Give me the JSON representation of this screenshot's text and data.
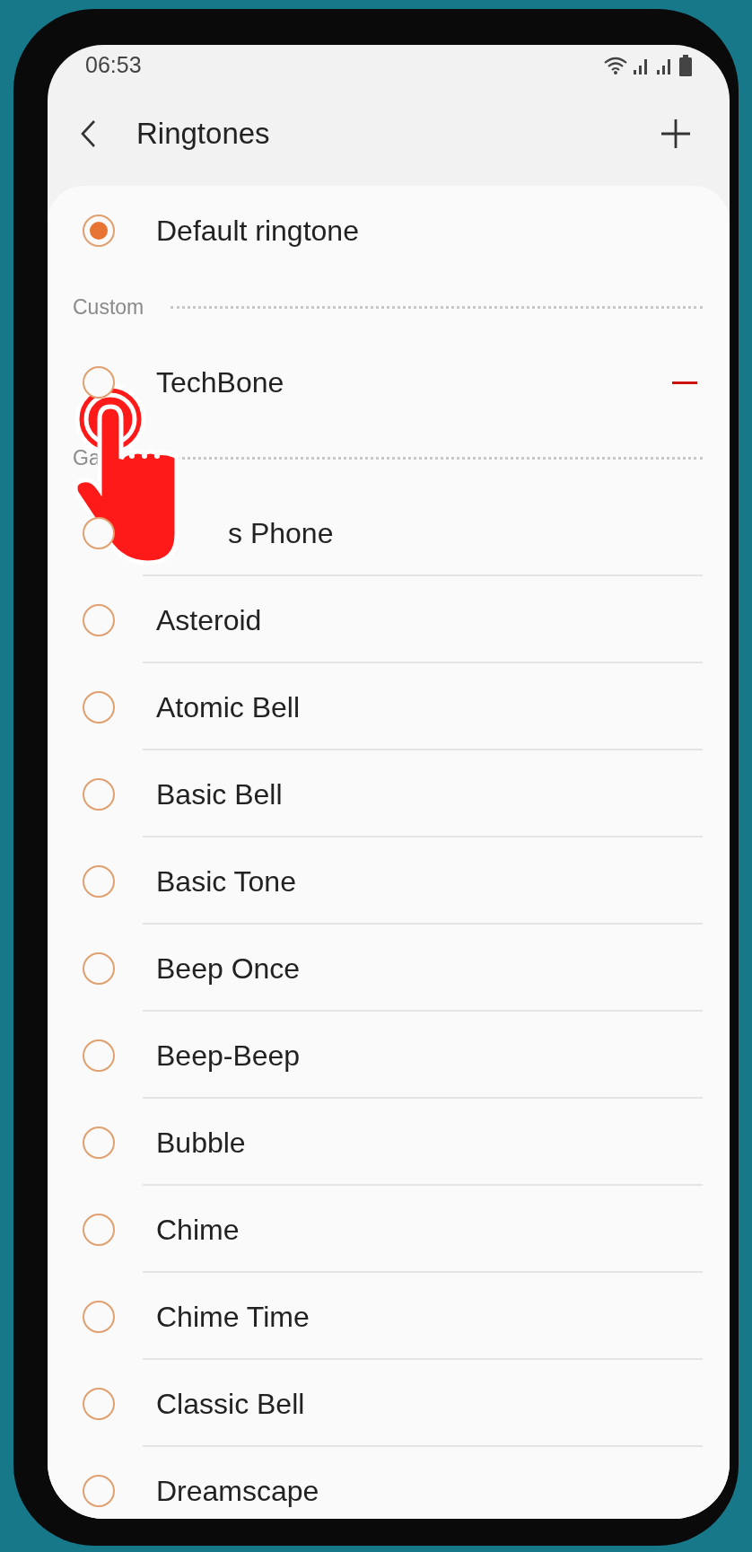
{
  "status_bar": {
    "time": "06:53"
  },
  "header": {
    "title": "Ringtones"
  },
  "default_item": {
    "label": "Default ringtone",
    "selected": true
  },
  "sections": [
    {
      "label": "Custom",
      "items": [
        {
          "label": "TechBone",
          "selected": false,
          "removable": true
        }
      ]
    },
    {
      "label": "Ga",
      "items": [
        {
          "label": "s Phone",
          "selected": false
        },
        {
          "label": "Asteroid",
          "selected": false
        },
        {
          "label": "Atomic Bell",
          "selected": false
        },
        {
          "label": "Basic Bell",
          "selected": false
        },
        {
          "label": "Basic Tone",
          "selected": false
        },
        {
          "label": "Beep Once",
          "selected": false
        },
        {
          "label": "Beep-Beep",
          "selected": false
        },
        {
          "label": "Bubble",
          "selected": false
        },
        {
          "label": "Chime",
          "selected": false
        },
        {
          "label": "Chime Time",
          "selected": false
        },
        {
          "label": "Classic Bell",
          "selected": false
        },
        {
          "label": "Dreamscape",
          "selected": false
        }
      ]
    }
  ]
}
